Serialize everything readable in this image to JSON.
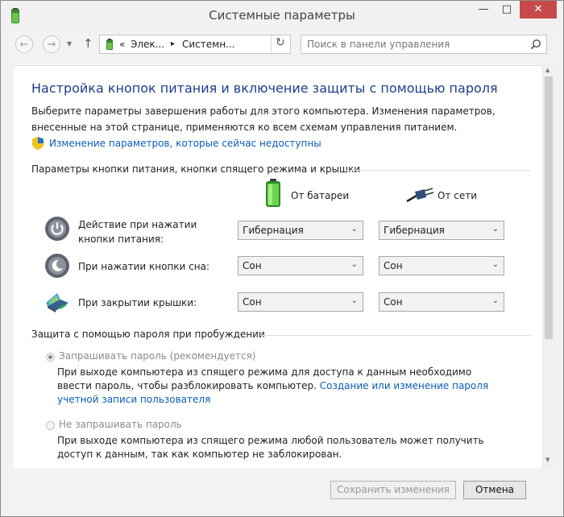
{
  "window": {
    "title": "Системные параметры",
    "minimize_glyph": "—",
    "maximize_glyph": "□",
    "close_glyph": "✕"
  },
  "nav": {
    "back_glyph": "←",
    "forward_glyph": "→",
    "dropdown_glyph": "▼",
    "up_glyph": "↑",
    "breadcrumb_prefix": "«",
    "breadcrumb_1": "Элек...",
    "breadcrumb_sep": "▸",
    "breadcrumb_2": "Системн...",
    "refresh_glyph": "↻",
    "search_placeholder": "Поиск в панели управления"
  },
  "page": {
    "heading": "Настройка кнопок питания и включение защиты с помощью пароля",
    "description": "Выберите параметры завершения работы для этого компьютера. Изменения параметров, внесенные на этой странице, применяются ко всем схемам управления питанием.",
    "change_unavailable_link": "Изменение параметров, которые сейчас недоступны"
  },
  "power_section": {
    "title": "Параметры кнопки питания, кнопки спящего режима и крышки",
    "col_battery": "От батареи",
    "col_ac": "От сети",
    "rows": [
      {
        "label": "Действие при нажатии кнопки питания:",
        "battery": "Гибернация",
        "ac": "Гибернация"
      },
      {
        "label": "При нажатии кнопки сна:",
        "battery": "Сон",
        "ac": "Сон"
      },
      {
        "label": "При закрытии крышки:",
        "battery": "Сон",
        "ac": "Сон"
      }
    ],
    "dropdown_arrow": "⌄"
  },
  "password_section": {
    "title": "Защита с помощью пароля при пробуждении",
    "option_require": {
      "label": "Запрашивать пароль (рекомендуется)",
      "selected": true,
      "description_before_link": "При выходе компьютера из спящего режима для доступа к данным необходимо ввести пароль, чтобы разблокировать компьютер.",
      "link": "Создание или изменение пароля учетной записи пользователя"
    },
    "option_no_password": {
      "label": "Не запрашивать пароль",
      "selected": false,
      "description": "При выходе компьютера из спящего режима любой пользователь может получить доступ к данным, так как компьютер не заблокирован."
    }
  },
  "footer": {
    "save_label": "Сохранить изменения",
    "cancel_label": "Отмена"
  },
  "scrollbar": {
    "up_glyph": "▲",
    "down_glyph": "▼"
  },
  "colors": {
    "heading": "#1e3e8a",
    "link": "#0b5db8",
    "close_button": "#c74a4a"
  }
}
